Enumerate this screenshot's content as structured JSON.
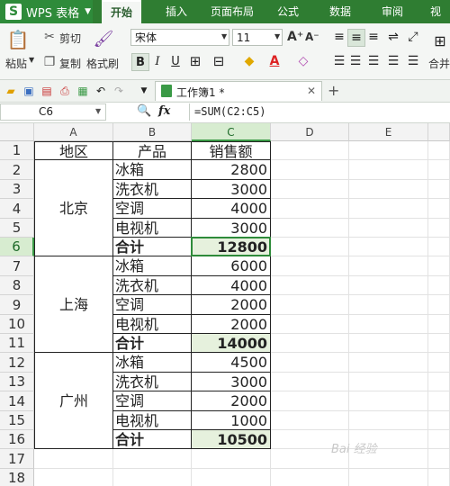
{
  "app": {
    "name": "WPS 表格",
    "logo": "S"
  },
  "menu": {
    "tabs": [
      "开始",
      "插入",
      "页面布局",
      "公式",
      "数据",
      "审阅",
      "视图"
    ]
  },
  "ribbon": {
    "paste": "粘贴",
    "cut": "剪切",
    "copy": "复制",
    "format_painter": "格式刷",
    "font_name": "宋体",
    "font_size": "11",
    "merge": "合并"
  },
  "document": {
    "tab_title": "工作簿1 *"
  },
  "formula_bar": {
    "name_box": "C6",
    "fx": "fx",
    "formula": "=SUM(C2:C5)"
  },
  "sheet": {
    "columns": [
      "A",
      "B",
      "C",
      "D",
      "E"
    ],
    "rows": [
      "1",
      "2",
      "3",
      "4",
      "5",
      "6",
      "7",
      "8",
      "9",
      "10",
      "11",
      "12",
      "13",
      "14",
      "15",
      "16",
      "17",
      "18"
    ],
    "headers": {
      "region": "地区",
      "product": "产品",
      "sales": "销售额"
    },
    "groups": [
      {
        "region": "北京",
        "items": [
          {
            "product": "冰箱",
            "sales": "2800"
          },
          {
            "product": "洗衣机",
            "sales": "3000"
          },
          {
            "product": "空调",
            "sales": "4000"
          },
          {
            "product": "电视机",
            "sales": "3000"
          }
        ],
        "total_label": "合计",
        "total": "12800"
      },
      {
        "region": "上海",
        "items": [
          {
            "product": "冰箱",
            "sales": "6000"
          },
          {
            "product": "洗衣机",
            "sales": "4000"
          },
          {
            "product": "空调",
            "sales": "2000"
          },
          {
            "product": "电视机",
            "sales": "2000"
          }
        ],
        "total_label": "合计",
        "total": "14000"
      },
      {
        "region": "广州",
        "items": [
          {
            "product": "冰箱",
            "sales": "4500"
          },
          {
            "product": "洗衣机",
            "sales": "3000"
          },
          {
            "product": "空调",
            "sales": "2000"
          },
          {
            "product": "电视机",
            "sales": "1000"
          }
        ],
        "total_label": "合计",
        "total": "10500"
      }
    ],
    "active_cell": "C6"
  },
  "watermark": "Bai 经验",
  "colors": {
    "brand": "#2f7d32",
    "selection": "#2e8b3a",
    "total_fill": "#e6f1dd"
  }
}
